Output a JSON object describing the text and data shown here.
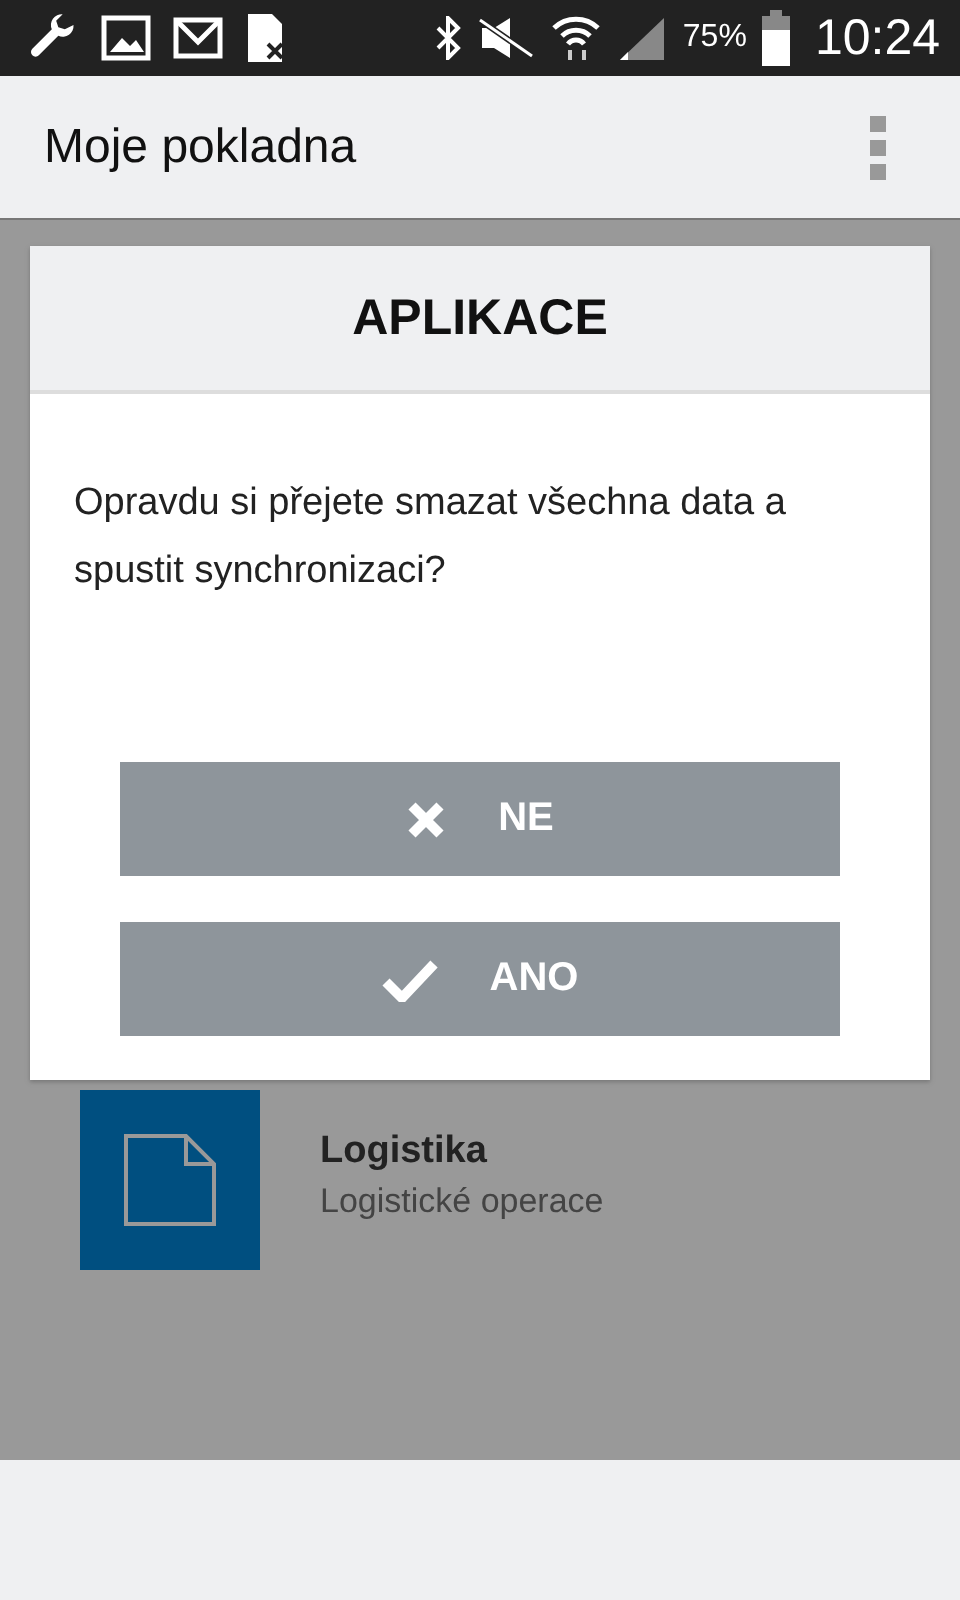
{
  "status_bar": {
    "battery_text": "75%",
    "time": "10:24"
  },
  "app_bar": {
    "title": "Moje pokladna"
  },
  "list_items": [
    {
      "title": "Logistika",
      "subtitle": "Logistické operace"
    }
  ],
  "dialog": {
    "title": "APLIKACE",
    "message": "Opravdu si přejete smazat všechna data a spustit synchronizaci?",
    "buttons": [
      {
        "kind": "cancel",
        "label": "NE"
      },
      {
        "kind": "confirm",
        "label": "ANO"
      }
    ]
  }
}
